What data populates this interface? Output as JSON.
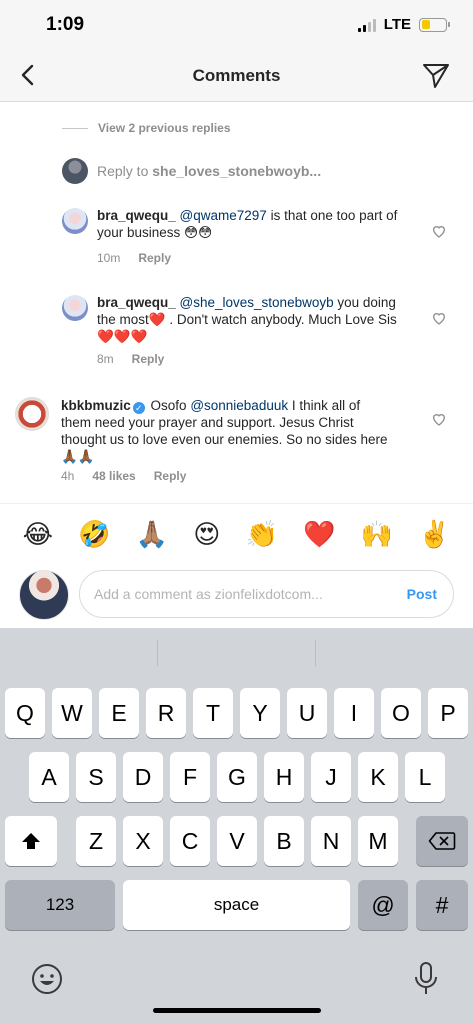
{
  "status_bar": {
    "time": "1:09",
    "network": "LTE",
    "battery_color": "#f5c800"
  },
  "header": {
    "title": "Comments"
  },
  "thread": {
    "view_previous": "View 2 previous replies",
    "reply_to_prefix": "Reply to ",
    "reply_to_user": "she_loves_stonebwoyb..."
  },
  "comments": [
    {
      "user": "bra_qwequ_",
      "mention": "@qwame7297",
      "text": " is that one too part of your business 😳😳",
      "time": "10m",
      "reply": "Reply"
    },
    {
      "user": "bra_qwequ_",
      "mention": "@she_loves_stonebwoyb",
      "text": " you doing the most❤️ . Don't watch anybody. Much Love Sis❤️❤️❤️",
      "time": "8m",
      "reply": "Reply"
    },
    {
      "user": "kbkbmuzic",
      "verified": true,
      "prefix": " Osofo ",
      "mention": "@sonniebaduuk",
      "text": " I think all of them need your prayer and support. Jesus Christ thought us to love even our enemies. So no sides here 🙏🏾🙏🏾",
      "time": "4h",
      "likes": "48 likes",
      "reply": "Reply"
    }
  ],
  "emoji_bar": [
    "😂",
    "🤣",
    "🙏🏽",
    "😍",
    "👏",
    "❤️",
    "🙌",
    "✌️"
  ],
  "comment_input": {
    "placeholder": "Add a comment as zionfelixdotcom...",
    "post_label": "Post"
  },
  "keyboard": {
    "row1": [
      "Q",
      "W",
      "E",
      "R",
      "T",
      "Y",
      "U",
      "I",
      "O",
      "P"
    ],
    "row2": [
      "A",
      "S",
      "D",
      "F",
      "G",
      "H",
      "J",
      "K",
      "L"
    ],
    "row3": [
      "Z",
      "X",
      "C",
      "V",
      "B",
      "N",
      "M"
    ],
    "numbers_label": "123",
    "space_label": "space",
    "at_label": "@",
    "hash_label": "#"
  },
  "icons": [
    "back-chevron-icon",
    "direct-send-icon",
    "heart-outline-icon",
    "shift-icon",
    "backspace-icon",
    "emoji-icon",
    "microphone-icon"
  ]
}
